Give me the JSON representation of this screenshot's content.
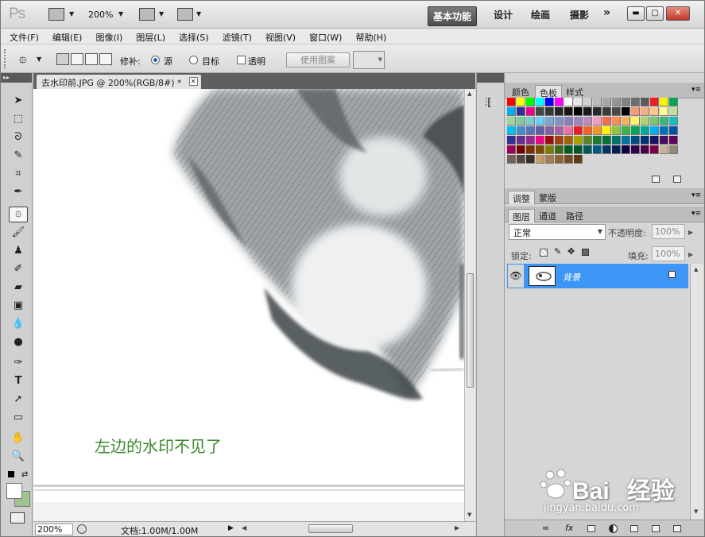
{
  "titlebar": {
    "app_logo": "Ps",
    "zoom": "200%",
    "workspaces": {
      "basic": "基本功能",
      "design": "设计",
      "painting": "绘画",
      "photo": "摄影",
      "more": "»"
    },
    "window_buttons": {
      "minimize": "▬",
      "maximize": "▢",
      "close": "✕"
    }
  },
  "menu": [
    "文件(F)",
    "编辑(E)",
    "图像(I)",
    "图层(L)",
    "选择(S)",
    "滤镜(T)",
    "视图(V)",
    "窗口(W)",
    "帮助(H)"
  ],
  "options": {
    "repair_label": "修补:",
    "source_label": "源",
    "target_label": "目标",
    "transparent_label": "透明",
    "use_pattern_label": "使用图案",
    "source_selected": true
  },
  "document": {
    "tab_title": "去水印前.JPG @ 200%(RGB/8#) *",
    "caption": "左边的水印不见了",
    "status_zoom": "200%",
    "status_doc": "文档:1.00M/1.00M"
  },
  "panels": {
    "swatch_tabs": [
      "颜色",
      "色板",
      "样式"
    ],
    "adjust_tabs": [
      "调整",
      "蒙版"
    ],
    "layer_tabs": [
      "图层",
      "通道",
      "路径"
    ],
    "blend_mode": "正常",
    "opacity_label": "不透明度:",
    "opacity_value": "100%",
    "lock_label": "锁定:",
    "fill_label": "填充:",
    "fill_value": "100%",
    "layer_name": "背景"
  },
  "swatch_colors": [
    [
      "#ff0000",
      "#ffff00",
      "#00ff00",
      "#00ffff",
      "#0000ff",
      "#ff00ff",
      "#ffffff",
      "#e6e6e6",
      "#d0d0d0",
      "#bcbcbc",
      "#a8a8a8",
      "#969696",
      "#828282",
      "#6e6e6e",
      "#5a5a5a",
      "#ee1c24",
      "#fff200",
      "#00a651"
    ],
    [
      "#00aeef",
      "#2e3192",
      "#ec008c",
      "#464646",
      "#363636",
      "#262626",
      "#161616",
      "#000000",
      "#1a1a1a",
      "#2a2a2a",
      "#3a3a3a",
      "#4a4a4a",
      "#000000",
      "#f7977a",
      "#fbad82",
      "#fdc68c",
      "#fff79a",
      "#c4df9b"
    ],
    [
      "#a2d39c",
      "#82ca9c",
      "#7accc8",
      "#6dcff6",
      "#7da7d9",
      "#8393ca",
      "#8781bd",
      "#a186be",
      "#bd8cbf",
      "#f49ac1",
      "#f26c4f",
      "#f68e55",
      "#fbaf5c",
      "#fff467",
      "#acd372",
      "#7cc576",
      "#3bb878",
      "#1abbb4"
    ],
    [
      "#00bff3",
      "#438ccb",
      "#5574b9",
      "#605ca8",
      "#855fa8",
      "#a763a8",
      "#f06ea9",
      "#ed1c24",
      "#f26522",
      "#f7941d",
      "#fff200",
      "#8dc63f",
      "#39b54a",
      "#00a651",
      "#00a99d",
      "#00aeef",
      "#0072bc",
      "#0054a6"
    ],
    [
      "#2e3192",
      "#662d91",
      "#92278f",
      "#ec008c",
      "#9e0b0f",
      "#a0410d",
      "#a36209",
      "#aba000",
      "#598527",
      "#1a7b30",
      "#007236",
      "#00746b",
      "#0076a3",
      "#004b80",
      "#003471",
      "#1b1464",
      "#440e62",
      "#630460"
    ],
    [
      "#9e005d",
      "#790000",
      "#7b2e00",
      "#7d4900",
      "#827b00",
      "#406618",
      "#005e20",
      "#005826",
      "#005952",
      "#005b7f",
      "#003663",
      "#002157",
      "#0d004c",
      "#32004b",
      "#4b0049",
      "#7b0046",
      "#c7b299",
      "#998675"
    ],
    [
      "#736357",
      "#534741",
      "#37302d",
      "#c69c6d",
      "#a67c52",
      "#8c6239",
      "#754c24",
      "#603913"
    ]
  ]
}
